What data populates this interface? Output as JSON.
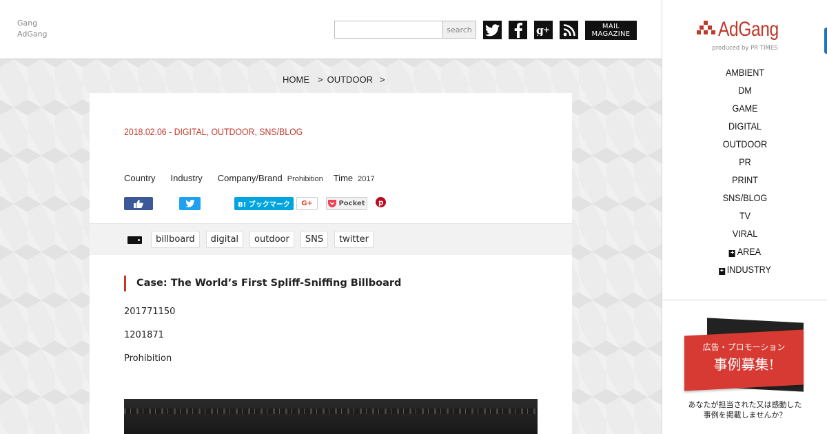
{
  "header": {
    "brand_line1": "Gang",
    "brand_line2": "AdGang",
    "search_placeholder": "",
    "search_button": "search",
    "mail_line1": "MAIL",
    "mail_line2": "MAGAZINE",
    "social_icons": [
      "twitter-icon",
      "facebook-icon",
      "google-plus-icon",
      "rss-icon"
    ]
  },
  "breadcrumb": {
    "home": "HOME",
    "sep1": ">",
    "section": "OUTDOOR",
    "sep2": ">"
  },
  "article": {
    "meta": "2018.02.06 - DIGITAL, OUTDOOR, SNS/BLOG",
    "facts": {
      "country_label": "Country",
      "industry_label": "Industry",
      "company_label": "Company/Brand",
      "company_value": "Prohibition",
      "time_label": "Time",
      "time_value": "2017"
    },
    "share": {
      "hatena": "B! ブックマーク",
      "gplus": "G+",
      "pocket": "Pocket"
    },
    "tags": [
      "billboard",
      "digital",
      "outdoor",
      "SNS",
      "twitter"
    ],
    "title": "Case: The World’s First Spliff-Sniffing Billboard",
    "paragraphs": [
      "201771150",
      "1201871",
      "Prohibition"
    ]
  },
  "sidebar": {
    "logo_text": "AdGang",
    "logo_sub": "produced by PR TIMES",
    "menu": [
      "AMBIENT",
      "DM",
      "GAME",
      "DIGITAL",
      "OUTDOOR",
      "PR",
      "PRINT",
      "SNS/BLOG",
      "TV",
      "VIRAL"
    ],
    "expand_area": "AREA",
    "expand_industry": "INDUSTRY",
    "banner_line1": "広告・プロモーション",
    "banner_line2": "事例募集!",
    "note_line1": "あなたが担当された又は感動した",
    "note_line2": "事例を掲載しませんか？"
  },
  "colors": {
    "accent": "#c0392b",
    "facebook": "#3b5998",
    "twitter": "#1da1f2",
    "hatena": "#00a4de",
    "pocket": "#ef4056",
    "pinterest": "#bd081c"
  }
}
